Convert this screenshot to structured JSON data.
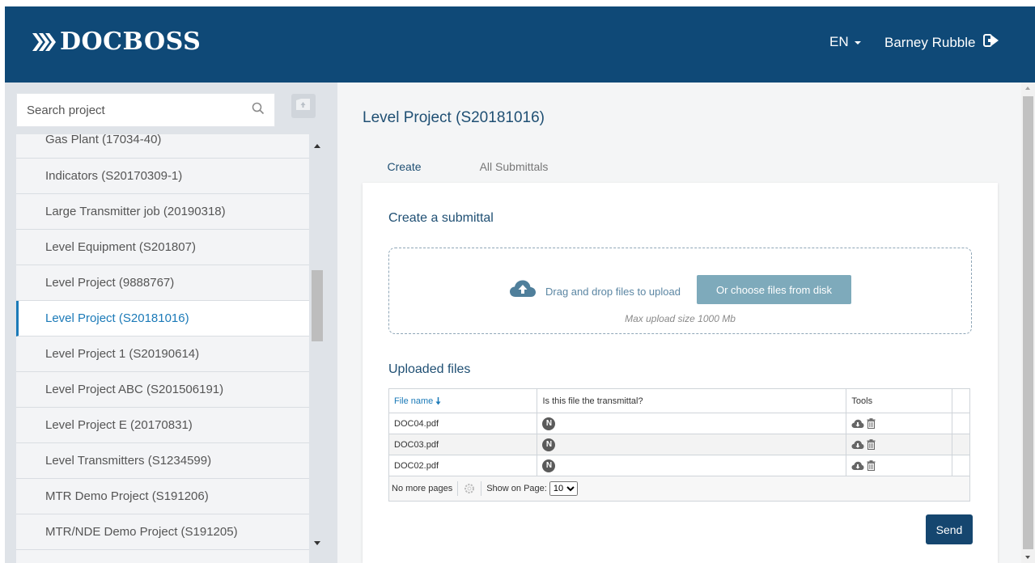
{
  "app": {
    "logo_text": "DOCBOSS",
    "language": "EN",
    "user_name": "Barney Rubble"
  },
  "sidebar": {
    "search_placeholder": "Search project",
    "projects": [
      {
        "label": "Gas Plant (17034-40)",
        "active": false
      },
      {
        "label": "Indicators (S20170309-1)",
        "active": false
      },
      {
        "label": "Large Transmitter job (20190318)",
        "active": false
      },
      {
        "label": "Level Equipment (S201807)",
        "active": false
      },
      {
        "label": "Level Project (9888767)",
        "active": false
      },
      {
        "label": "Level Project (S20181016)",
        "active": true
      },
      {
        "label": "Level Project 1 (S20190614)",
        "active": false
      },
      {
        "label": "Level Project ABC (S201506191)",
        "active": false
      },
      {
        "label": "Level Project E (20170831)",
        "active": false
      },
      {
        "label": "Level Transmitters (S1234599)",
        "active": false
      },
      {
        "label": "MTR Demo Project (S191206)",
        "active": false
      },
      {
        "label": "MTR/NDE Demo Project (S191205)",
        "active": false
      }
    ]
  },
  "main": {
    "title": "Level Project (S20181016)",
    "tabs": [
      {
        "label": "Create",
        "active": true
      },
      {
        "label": "All Submittals",
        "active": false
      }
    ],
    "create_title": "Create a submittal",
    "dropzone": {
      "drag_text": "Drag and drop files to upload",
      "choose_button": "Or choose files from disk",
      "max_size_text": "Max upload size 1000 Mb"
    },
    "uploaded_title": "Uploaded files",
    "table": {
      "headers": {
        "file_name": "File name",
        "transmittal": "Is this file the transmittal?",
        "tools": "Tools"
      },
      "rows": [
        {
          "file_name": "DOC04.pdf",
          "transmittal": "N"
        },
        {
          "file_name": "DOC03.pdf",
          "transmittal": "N"
        },
        {
          "file_name": "DOC02.pdf",
          "transmittal": "N"
        }
      ],
      "pager": {
        "no_more_pages": "No more pages",
        "show_on_page_label": "Show on Page:",
        "page_size": "10"
      }
    },
    "send_button": "Send"
  },
  "colors": {
    "header_bg": "#0f4977",
    "accent": "#1b7ab8",
    "send_button": "#15466f",
    "choose_button": "#7eaabb"
  }
}
